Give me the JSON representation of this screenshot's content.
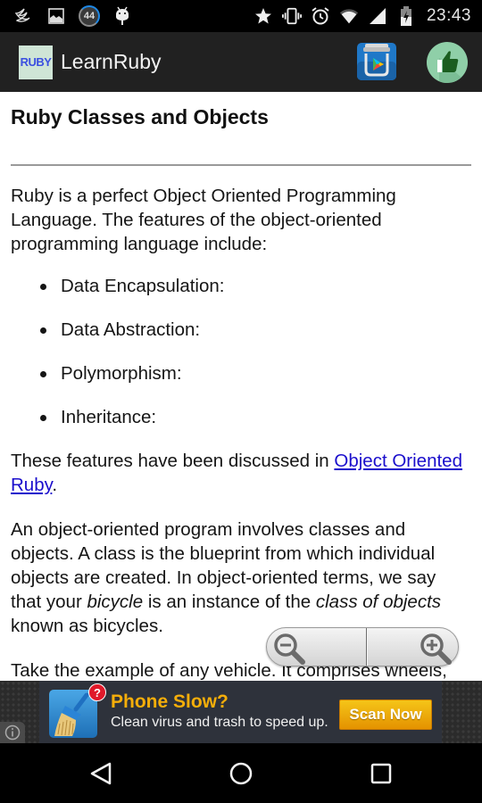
{
  "status_bar": {
    "left_icons": [
      "swift-app-icon",
      "gallery-icon",
      "notification-count-badge",
      "android-icon"
    ],
    "notification_count": "44",
    "right_icons": [
      "star-icon",
      "vibrate-icon",
      "alarm-icon",
      "wifi-icon",
      "signal-icon",
      "battery-charging-icon"
    ],
    "time": "23:43"
  },
  "app_bar": {
    "logo_text": "RUBY",
    "title": "LearnRuby",
    "actions": [
      "play-store-icon",
      "thumbs-up-icon"
    ],
    "colors": {
      "background": "#212121",
      "logo_bg": "#cfe5d6",
      "logo_text": "#3b4fe0",
      "like_bg": "#8fcfa8",
      "like_fg": "#1b5e20"
    }
  },
  "article": {
    "title": "Ruby Classes and Objects",
    "intro": "Ruby is a perfect Object Oriented Programming Language. The features of the object-oriented programming language include:",
    "features": [
      "Data Encapsulation:",
      "Data Abstraction:",
      "Polymorphism:",
      "Inheritance:"
    ],
    "discussed_prefix": "These features have been discussed in ",
    "discussed_link": "Object Oriented Ruby",
    "discussed_suffix": ".",
    "para2_a": "An object-oriented program involves classes and objects. A class is the blueprint from which individual objects are created. In object-oriented terms, we say that your ",
    "para2_em1": "bicycle",
    "para2_b": " is an instance of the ",
    "para2_em2": "class of objects",
    "para2_c": " known as bicycles.",
    "para3": "Take the example of any vehicle. It comprises wheels, horsepower, and fuel or gas tank capacity.",
    "link_color": "#1a0dcc"
  },
  "zoom_controls": {
    "zoom_out": "zoom-out-icon",
    "zoom_in": "zoom-in-icon"
  },
  "ad": {
    "info_icon": "info-icon",
    "badge": "?",
    "headline": "Phone Slow?",
    "subtext": "Clean virus and trash to speed up.",
    "cta": "Scan Now",
    "colors": {
      "headline": "#f5ae0a",
      "cta_bg": "#f0b000",
      "badge": "#e0192a"
    }
  },
  "nav_bar": {
    "buttons": [
      "back-icon",
      "home-icon",
      "recents-icon"
    ]
  }
}
